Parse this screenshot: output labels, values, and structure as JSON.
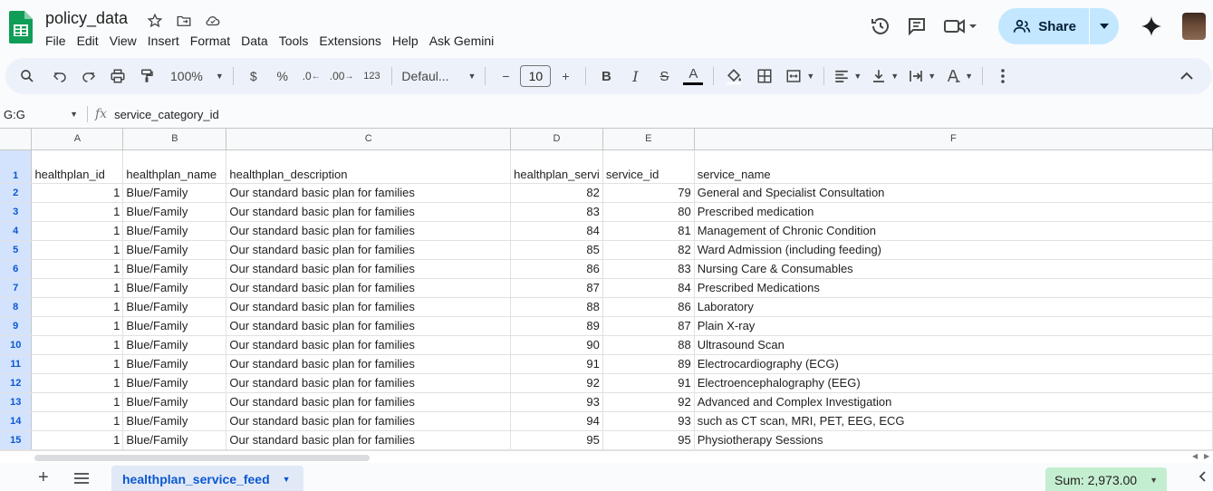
{
  "doc": {
    "title": "policy_data",
    "menu": [
      "File",
      "Edit",
      "View",
      "Insert",
      "Format",
      "Data",
      "Tools",
      "Extensions",
      "Help",
      "Ask Gemini"
    ],
    "share_label": "Share"
  },
  "toolbar": {
    "zoom": "100%",
    "currency": "$",
    "percent": "%",
    "dec_decrease": ".0",
    "dec_increase": ".00",
    "number_format": "123",
    "font": "Defaul...",
    "font_size": "10",
    "minus": "−",
    "plus": "+",
    "bold": "B",
    "italic": "I",
    "strike": "S",
    "text_color_glyph": "A"
  },
  "formula_bar": {
    "name_box": "G:G",
    "fx": "fx",
    "content": "service_category_id"
  },
  "grid": {
    "columns": [
      "A",
      "B",
      "C",
      "D",
      "E",
      "F"
    ],
    "header_row": {
      "row_num": "1",
      "cells": [
        "healthplan_id",
        "healthplan_name",
        "healthplan_description",
        "healthplan_servi",
        "service_id",
        "service_name"
      ]
    },
    "rows": [
      {
        "n": "2",
        "a": "1",
        "b": "Blue/Family",
        "c": "Our standard basic plan for families",
        "d": "82",
        "e": "79",
        "f": "General and Specialist Consultation"
      },
      {
        "n": "3",
        "a": "1",
        "b": "Blue/Family",
        "c": "Our standard basic plan for families",
        "d": "83",
        "e": "80",
        "f": "Prescribed medication"
      },
      {
        "n": "4",
        "a": "1",
        "b": "Blue/Family",
        "c": "Our standard basic plan for families",
        "d": "84",
        "e": "81",
        "f": "Management of Chronic Condition"
      },
      {
        "n": "5",
        "a": "1",
        "b": "Blue/Family",
        "c": "Our standard basic plan for families",
        "d": "85",
        "e": "82",
        "f": "Ward Admission (including feeding)"
      },
      {
        "n": "6",
        "a": "1",
        "b": "Blue/Family",
        "c": "Our standard basic plan for families",
        "d": "86",
        "e": "83",
        "f": "Nursing Care & Consumables"
      },
      {
        "n": "7",
        "a": "1",
        "b": "Blue/Family",
        "c": "Our standard basic plan for families",
        "d": "87",
        "e": "84",
        "f": "Prescribed Medications"
      },
      {
        "n": "8",
        "a": "1",
        "b": "Blue/Family",
        "c": "Our standard basic plan for families",
        "d": "88",
        "e": "86",
        "f": "Laboratory"
      },
      {
        "n": "9",
        "a": "1",
        "b": "Blue/Family",
        "c": "Our standard basic plan for families",
        "d": "89",
        "e": "87",
        "f": "Plain X-ray"
      },
      {
        "n": "10",
        "a": "1",
        "b": "Blue/Family",
        "c": "Our standard basic plan for families",
        "d": "90",
        "e": "88",
        "f": "Ultrasound Scan"
      },
      {
        "n": "11",
        "a": "1",
        "b": "Blue/Family",
        "c": "Our standard basic plan for families",
        "d": "91",
        "e": "89",
        "f": "Electrocardiography (ECG)"
      },
      {
        "n": "12",
        "a": "1",
        "b": "Blue/Family",
        "c": "Our standard basic plan for families",
        "d": "92",
        "e": "91",
        "f": "Electroencephalography (EEG)"
      },
      {
        "n": "13",
        "a": "1",
        "b": "Blue/Family",
        "c": "Our standard basic plan for families",
        "d": "93",
        "e": "92",
        "f": "Advanced and Complex Investigation"
      },
      {
        "n": "14",
        "a": "1",
        "b": "Blue/Family",
        "c": "Our standard basic plan for families",
        "d": "94",
        "e": "93",
        "f": "such as CT scan, MRI, PET, EEG, ECG"
      },
      {
        "n": "15",
        "a": "1",
        "b": "Blue/Family",
        "c": "Our standard basic plan for families",
        "d": "95",
        "e": "95",
        "f": "Physiotherapy Sessions"
      }
    ]
  },
  "bottom": {
    "add_sheet": "+",
    "sheet_tab": "healthplan_service_feed",
    "sum": "Sum: 2,973.00"
  },
  "colors": {
    "accent": "#0b57d0",
    "share_bg": "#c2e7ff",
    "toolbar_bg": "#edf2fa",
    "sum_bg": "#c4eed0",
    "selected_header": "#d3e3fd"
  }
}
